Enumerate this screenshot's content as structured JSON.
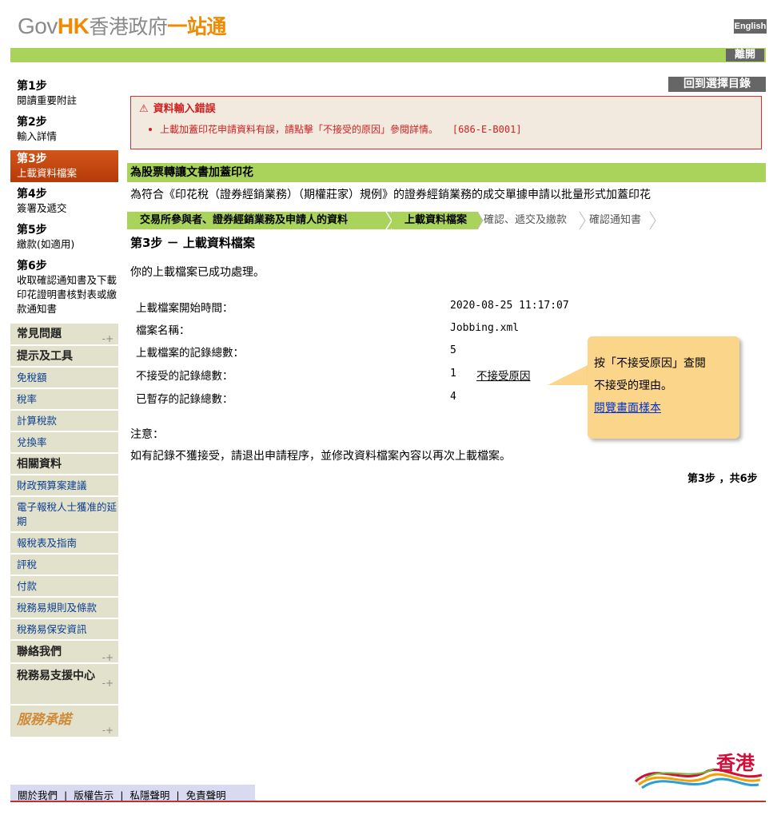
{
  "header": {
    "logo_gov": "Gov",
    "logo_hk": "HK",
    "logo_zh1": "香港政府",
    "logo_zh2": "一站通",
    "english_label": "English",
    "logout_label": "離開"
  },
  "steps": [
    {
      "title": "第1步",
      "desc": "閱讀重要附註"
    },
    {
      "title": "第2步",
      "desc": "輸入詳情"
    },
    {
      "title": "第3步",
      "desc": "上載資料檔案"
    },
    {
      "title": "第4步",
      "desc": "簽署及遞交"
    },
    {
      "title": "第5步",
      "desc": "繳款(如適用)"
    },
    {
      "title": "第6步",
      "desc": "收取確認通知書及下載印花證明書核對表或繳款通知書"
    }
  ],
  "menu": {
    "faq": "常見問題",
    "tips": "提示及工具",
    "tips_items": [
      "免稅額",
      "稅率",
      "計算稅款",
      "兌換率"
    ],
    "related": "相關資料",
    "related_items": [
      "財政預算案建議",
      "電子報稅人士獲准的延期",
      "報稅表及指南",
      "評稅",
      "付款",
      "稅務易規則及條款",
      "稅務易保安資訊"
    ],
    "contact": "聯絡我們",
    "support": "稅務易支援中心",
    "pledge": "服務承諾"
  },
  "main": {
    "back_label": "回到選擇目錄",
    "error_title": "資料輸入錯誤",
    "error_msg": "上載加蓋印花申請資料有誤，請點擊「不接受的原因」參閱詳情。",
    "error_code": "[686-E-B001]",
    "section_title": "為股票轉讓文書加蓋印花",
    "section_desc": "為符合《印花稅（證券經銷業務）（期權莊家）規例》的證券經銷業務的成交單據申請以批量形式加蓋印花",
    "progress": [
      "交易所參與者、證券經銷業務及申請人的資料",
      "上載資料檔案",
      "確認、遞交及繳款",
      "確認通知書"
    ],
    "step_heading": "第3步 － 上載資料檔案",
    "success_msg": "你的上載檔案已成功處理。",
    "rows": [
      {
        "label": "上載檔案開始時間：",
        "value": "2020-08-25 11:17:07"
      },
      {
        "label": "檔案名稱：",
        "value": "Jobbing.xml"
      },
      {
        "label": "上載檔案的記錄總數：",
        "value": "5"
      },
      {
        "label": "不接受的記錄總數：",
        "value": "1"
      },
      {
        "label": "已暫存的記錄總數：",
        "value": "4"
      }
    ],
    "reject_link": "不接受原因",
    "tooltip_line1": "按「不接受原因」查閱",
    "tooltip_line2": "不接受的理由。",
    "tooltip_link": "閱覽畫面樣本",
    "note_label": "注意：",
    "note_text": "如有記錄不獲接受，請退出申請程序，並修改資料檔案內容以再次上載檔案。",
    "step_count": "第3步 ，共6步"
  },
  "footer": {
    "links": [
      "關於我們",
      "版權告示",
      "私隱聲明",
      "免責聲明"
    ],
    "brand": "香港"
  }
}
